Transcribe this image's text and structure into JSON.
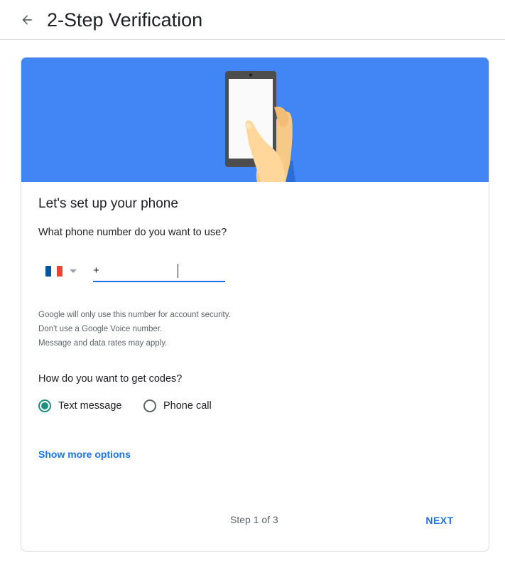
{
  "header": {
    "title": "2-Step Verification",
    "back_icon": "arrow-back-icon"
  },
  "colors": {
    "hero_background": "#4285f4",
    "accent": "#1a73e8",
    "radio_selected": "#1e8e7e"
  },
  "card": {
    "illustration": "hand-holding-phone",
    "title": "Let's set up your phone",
    "phone_question": "What phone number do you want to use?",
    "country": {
      "selected_flag": "flag-france-icon",
      "flag_colors": [
        "#0055a4",
        "#ffffff",
        "#ef4135"
      ],
      "dropdown_icon": "caret-down-icon"
    },
    "phone_input": {
      "value": "+"
    },
    "help_lines": [
      "Google will only use this number for account security.",
      "Don't use a Google Voice number.",
      "Message and data rates may apply."
    ],
    "codes_question": "How do you want to get codes?",
    "methods": [
      {
        "label": "Text message",
        "selected": true
      },
      {
        "label": "Phone call",
        "selected": false
      }
    ],
    "more_options": "Show more options",
    "step_text": "Step 1 of 3",
    "next_label": "NEXT"
  }
}
